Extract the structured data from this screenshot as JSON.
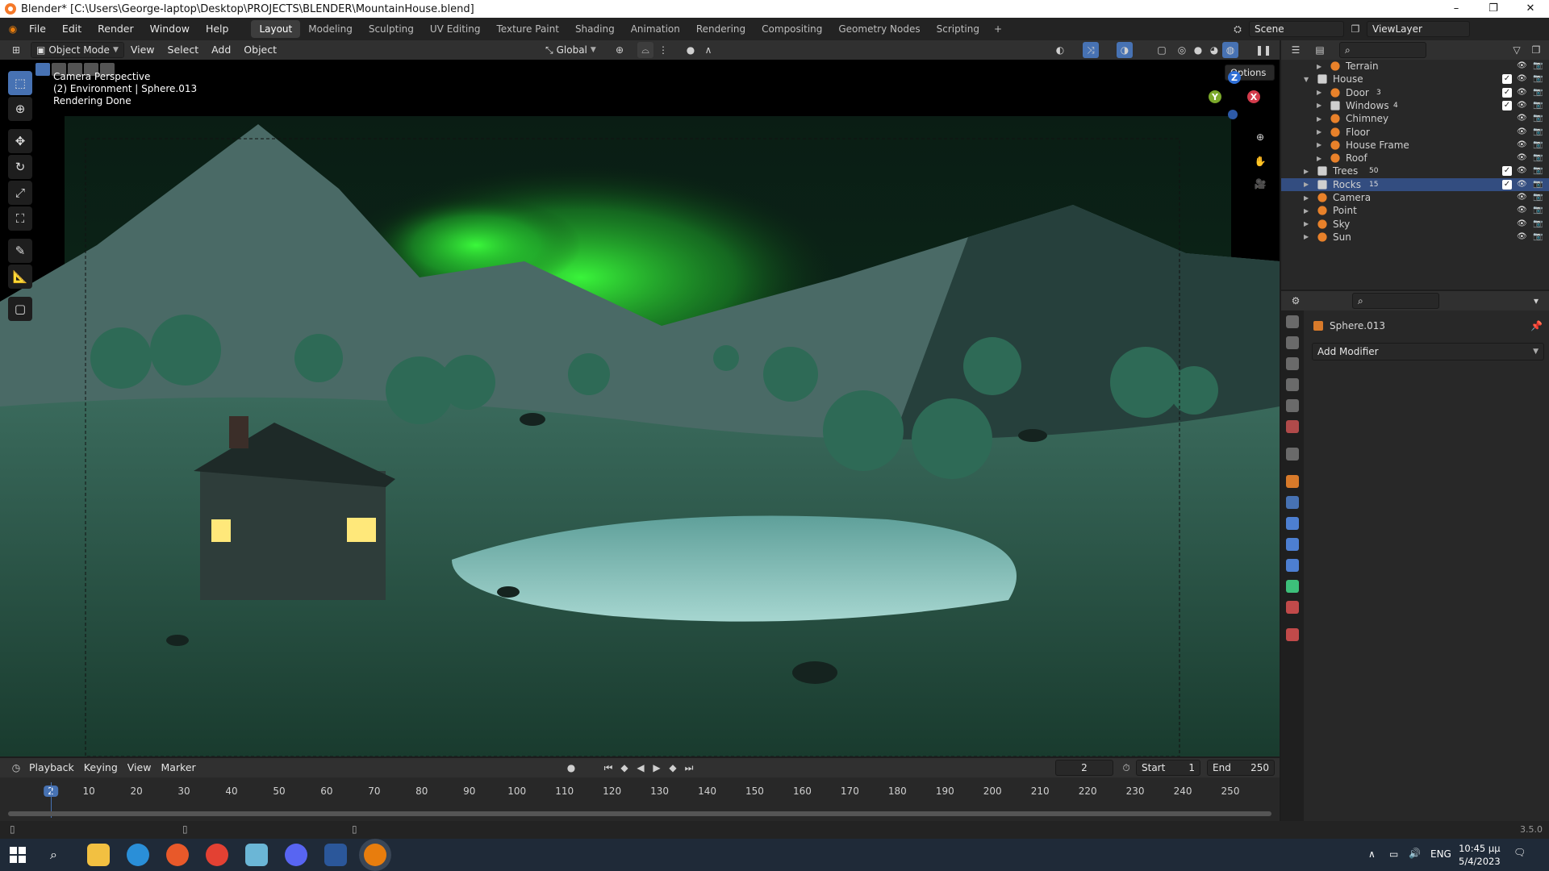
{
  "window": {
    "title": "Blender* [C:\\Users\\George-laptop\\Desktop\\PROJECTS\\BLENDER\\MountainHouse.blend]",
    "minimize": "–",
    "maximize": "❐",
    "close": "✕"
  },
  "menu": [
    "File",
    "Edit",
    "Render",
    "Window",
    "Help"
  ],
  "workspaces": [
    "Layout",
    "Modeling",
    "Sculpting",
    "UV Editing",
    "Texture Paint",
    "Shading",
    "Animation",
    "Rendering",
    "Compositing",
    "Geometry Nodes",
    "Scripting"
  ],
  "workspace_add": "+",
  "scene": {
    "name": "Scene",
    "view_layer": "ViewLayer"
  },
  "viewport_header": {
    "mode": "Object Mode",
    "menus": [
      "View",
      "Select",
      "Add",
      "Object"
    ],
    "orientation": "Global",
    "options": "Options"
  },
  "viewport_overlay": {
    "line1": "Camera Perspective",
    "line2": "(2) Environment | Sphere.013",
    "line3": "Rendering Done"
  },
  "gizmo": {
    "z": "Z",
    "y": "Y",
    "x": "X"
  },
  "outliner": {
    "rows": [
      {
        "name": "Terrain",
        "indent": 2,
        "expanded": false,
        "icon": "mesh-icon",
        "badge": "",
        "check": false,
        "visible": true
      },
      {
        "name": "House",
        "indent": 1,
        "expanded": true,
        "icon": "collection-icon",
        "badge": "",
        "check": true,
        "visible": true
      },
      {
        "name": "Door",
        "indent": 2,
        "expanded": false,
        "icon": "mesh-icon",
        "badge": "3",
        "check": true,
        "visible": true
      },
      {
        "name": "Windows",
        "indent": 2,
        "expanded": false,
        "icon": "collection-icon",
        "badge": "4",
        "check": true,
        "visible": true
      },
      {
        "name": "Chimney",
        "indent": 2,
        "expanded": false,
        "icon": "mesh-icon",
        "badge": "",
        "check": false,
        "visible": true
      },
      {
        "name": "Floor",
        "indent": 2,
        "expanded": false,
        "icon": "mesh-icon",
        "badge": "",
        "check": false,
        "visible": true
      },
      {
        "name": "House Frame",
        "indent": 2,
        "expanded": false,
        "icon": "mesh-icon",
        "badge": "",
        "check": false,
        "visible": true
      },
      {
        "name": "Roof",
        "indent": 2,
        "expanded": false,
        "icon": "mesh-icon",
        "badge": "",
        "check": false,
        "visible": true
      },
      {
        "name": "Trees",
        "indent": 1,
        "expanded": false,
        "icon": "collection-icon",
        "badge": "50",
        "check": true,
        "visible": true
      },
      {
        "name": "Rocks",
        "indent": 1,
        "expanded": false,
        "icon": "collection-icon",
        "badge": "15",
        "check": true,
        "visible": true,
        "selected": true
      },
      {
        "name": "Camera",
        "indent": 1,
        "expanded": false,
        "icon": "camera-icon",
        "badge": "",
        "check": false,
        "visible": true
      },
      {
        "name": "Point",
        "indent": 1,
        "expanded": false,
        "icon": "light-icon",
        "badge": "",
        "check": false,
        "visible": true
      },
      {
        "name": "Sky",
        "indent": 1,
        "expanded": false,
        "icon": "image-icon",
        "badge": "",
        "check": false,
        "visible": true
      },
      {
        "name": "Sun",
        "indent": 1,
        "expanded": false,
        "icon": "light-icon",
        "badge": "",
        "check": false,
        "visible": true
      }
    ]
  },
  "properties": {
    "object_name": "Sphere.013",
    "add_modifier": "Add Modifier"
  },
  "timeline": {
    "menus": [
      "Playback",
      "Keying",
      "View",
      "Marker"
    ],
    "current_frame": "2",
    "start_label": "Start",
    "start": "1",
    "end_label": "End",
    "end": "250",
    "ticks": [
      "2",
      "10",
      "20",
      "30",
      "40",
      "50",
      "60",
      "70",
      "80",
      "90",
      "100",
      "110",
      "120",
      "130",
      "140",
      "150",
      "160",
      "170",
      "180",
      "190",
      "200",
      "210",
      "220",
      "230",
      "240",
      "250"
    ]
  },
  "status": {
    "version": "3.5.0"
  },
  "taskbar": {
    "lang": "ENG",
    "time": "10:45 μμ",
    "date": "5/4/2023"
  },
  "colors": {
    "accent": "#4772b3",
    "selected_row": "#334d80",
    "aurora": "#2bd33a",
    "window_light": "#ffe87a"
  }
}
